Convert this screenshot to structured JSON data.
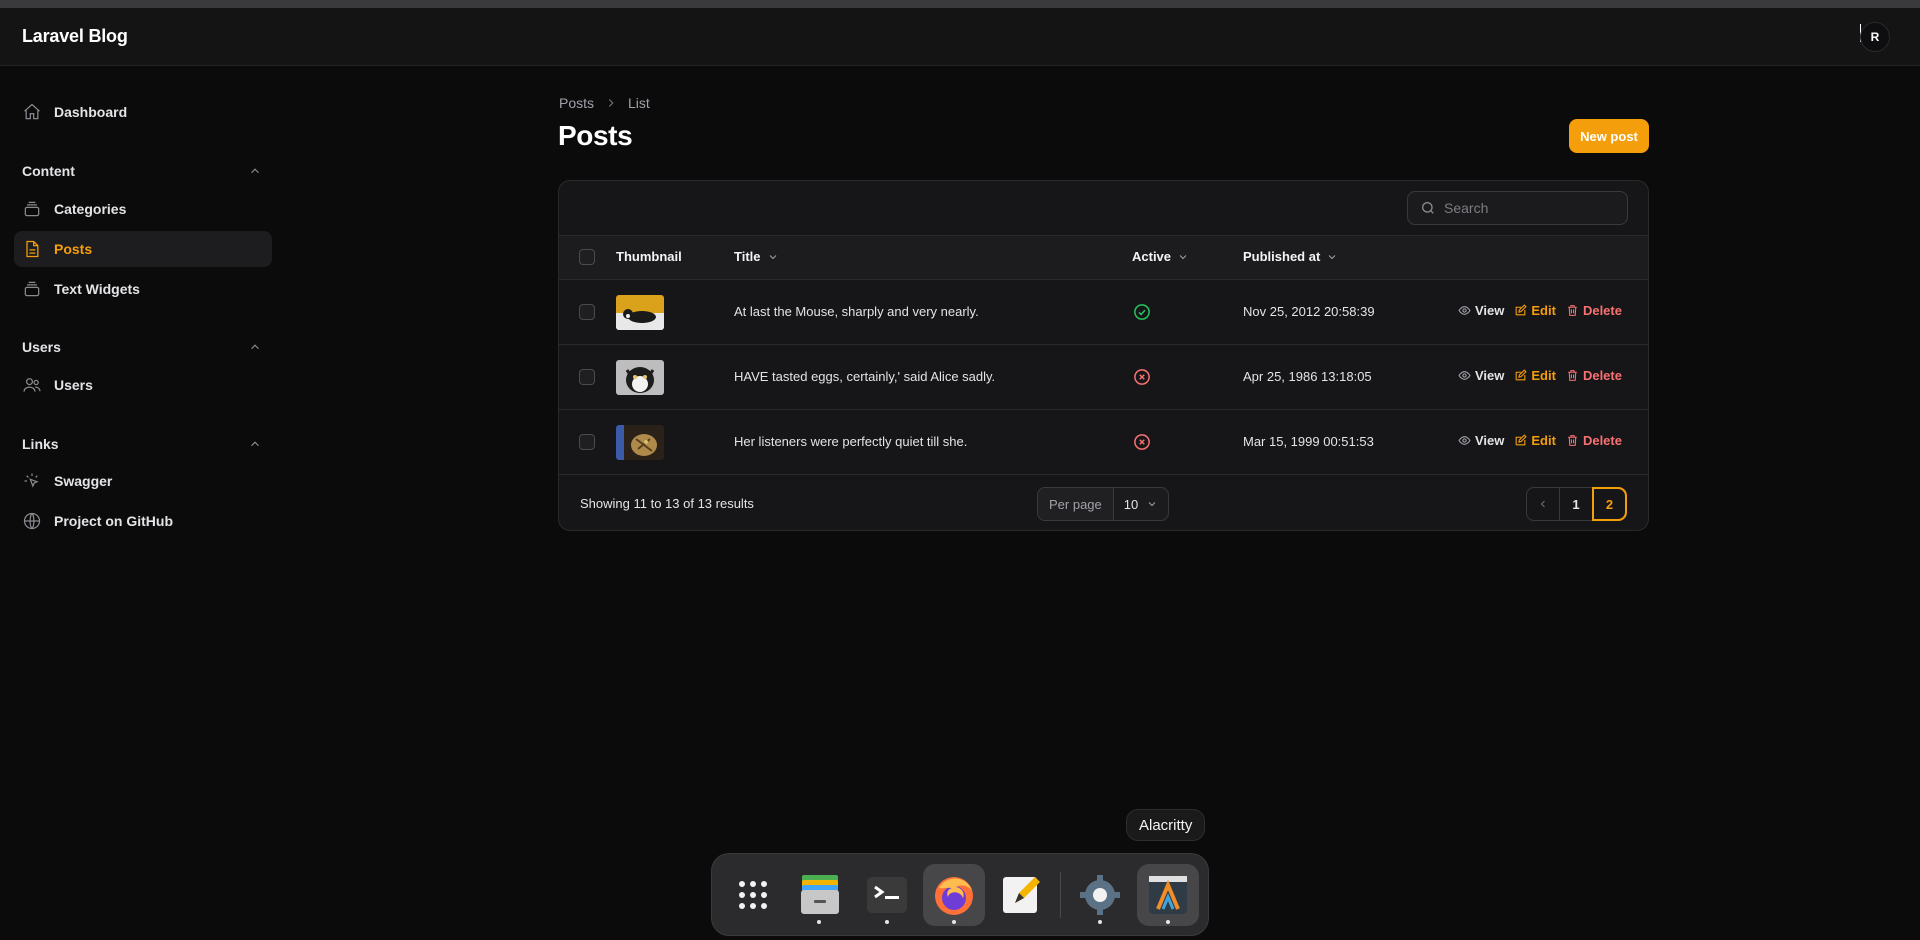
{
  "app": {
    "brand": "Laravel Blog",
    "avatar_initial": "R"
  },
  "sidebar": {
    "dashboard": "Dashboard",
    "groups": {
      "content": {
        "label": "Content",
        "items": [
          "Categories",
          "Posts",
          "Text Widgets"
        ]
      },
      "users": {
        "label": "Users",
        "items": [
          "Users"
        ]
      },
      "links": {
        "label": "Links",
        "items": [
          "Swagger",
          "Project on GitHub"
        ]
      }
    },
    "active_item": "Posts"
  },
  "breadcrumb": [
    "Posts",
    "List"
  ],
  "page": {
    "title": "Posts",
    "new_button": "New post"
  },
  "table": {
    "search_placeholder": "Search",
    "columns": [
      "Thumbnail",
      "Title",
      "Active",
      "Published at"
    ],
    "rows": [
      {
        "title": "At last the Mouse, sharply and very nearly.",
        "active": true,
        "published_at": "Nov 25, 2012 20:58:39"
      },
      {
        "title": "HAVE tasted eggs, certainly,' said Alice sadly.",
        "active": false,
        "published_at": "Apr 25, 1986 13:18:05"
      },
      {
        "title": "Her listeners were perfectly quiet till she.",
        "active": false,
        "published_at": "Mar 15, 1999 00:51:53"
      }
    ],
    "actions": {
      "view": "View",
      "edit": "Edit",
      "delete": "Delete"
    },
    "footer": {
      "showing": "Showing 11 to 13 of 13 results",
      "per_page_label": "Per page",
      "per_page_value": "10",
      "pages": [
        "1",
        "2"
      ],
      "current_page": "2"
    }
  },
  "dock": {
    "tooltip": "Alacritty",
    "apps": [
      "app-grid",
      "files",
      "terminal",
      "firefox",
      "text-editor",
      "settings",
      "alacritty"
    ]
  },
  "colors": {
    "accent": "#f59e0b",
    "success": "#22c55e",
    "danger": "#f87171",
    "background": "#0b0b0c"
  }
}
